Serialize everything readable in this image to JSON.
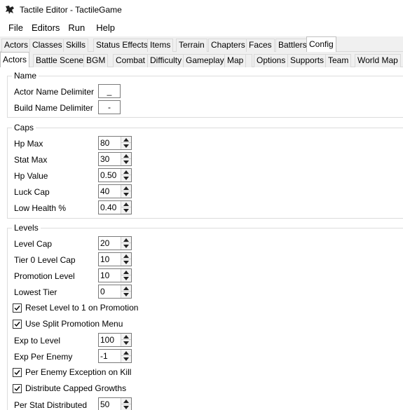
{
  "window": {
    "title": "Tactile Editor - TactileGame",
    "icon": "app-icon"
  },
  "menu": [
    "File",
    "Editors",
    "Run",
    "Help"
  ],
  "tabs_top": [
    "Actors",
    "Classes",
    "Skills",
    "Status Effects",
    "Items",
    "Terrain",
    "Chapters",
    "Faces",
    "Battlers",
    "Config"
  ],
  "tabs_top_active": "Config",
  "tabs_sub": [
    "Actors",
    "Battle Scene",
    "BGM",
    "Combat",
    "Difficulty",
    "Gameplay",
    "Map",
    "",
    "Options",
    "Supports",
    "Team",
    "World Map"
  ],
  "tabs_sub_active": "Actors",
  "name_group": {
    "title": "Name",
    "actor_delim_label": "Actor Name Delimiter",
    "actor_delim_value": "_",
    "build_delim_label": "Build Name Delimiter",
    "build_delim_value": "-"
  },
  "caps_group": {
    "title": "Caps",
    "fields": [
      {
        "label": "Hp Max",
        "value": "80"
      },
      {
        "label": "Stat Max",
        "value": "30"
      },
      {
        "label": "Hp Value",
        "value": "0.50"
      },
      {
        "label": "Luck Cap",
        "value": "40"
      },
      {
        "label": "Low Health %",
        "value": "0.40"
      }
    ]
  },
  "levels_group": {
    "title": "Levels",
    "fields": [
      {
        "label": "Level Cap",
        "value": "20"
      },
      {
        "label": "Tier 0 Level Cap",
        "value": "10"
      },
      {
        "label": "Promotion Level",
        "value": "10"
      },
      {
        "label": "Lowest Tier",
        "value": "0"
      }
    ],
    "check_reset": {
      "label": "Reset Level to 1 on Promotion",
      "checked": true
    },
    "check_split": {
      "label": "Use Split Promotion Menu",
      "checked": true
    },
    "exp_fields": [
      {
        "label": "Exp to Level",
        "value": "100"
      },
      {
        "label": "Exp Per Enemy",
        "value": "-1"
      }
    ],
    "check_per_enemy": {
      "label": "Per Enemy Exception on Kill",
      "checked": true
    },
    "check_distribute": {
      "label": "Distribute Capped Growths",
      "checked": true
    },
    "per_stat": {
      "label": "Per Stat Distributed",
      "value": "50"
    }
  }
}
